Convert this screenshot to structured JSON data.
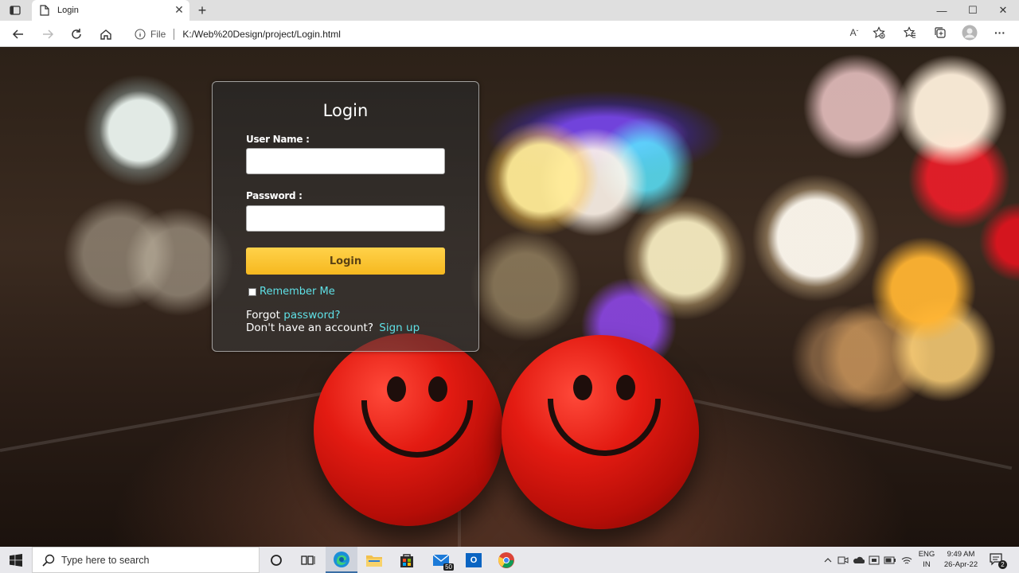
{
  "browser": {
    "tab_title": "Login",
    "new_tab_symbol": "+",
    "close_tab_symbol": "✕",
    "window_controls": {
      "minimize": "—",
      "maximize": "☐",
      "close": "✕"
    },
    "address": {
      "protocol": "File",
      "url": "K:/Web%20Design/project/Login.html"
    },
    "read_aloud_label": "A",
    "more_label": "···"
  },
  "login_form": {
    "title": "Login",
    "username_label": "User Name :",
    "username_value": "",
    "password_label": "Password :",
    "password_value": "",
    "submit_label": "Login",
    "remember_label": "Remember Me",
    "remember_checked": false,
    "forgot_prefix": "Forgot",
    "forgot_link": "password?",
    "signup_prefix": "Don't have an account?",
    "signup_link": "Sign up",
    "accent_color": "#5fe0e6",
    "button_color": "#f6b81f"
  },
  "taskbar": {
    "search_placeholder": "Type here to search",
    "mail_badge": "50",
    "outlook_letter": "O",
    "lang_top": "ENG",
    "lang_bottom": "IN",
    "time": "9:49 AM",
    "date": "26-Apr-22",
    "notification_count": "2"
  }
}
